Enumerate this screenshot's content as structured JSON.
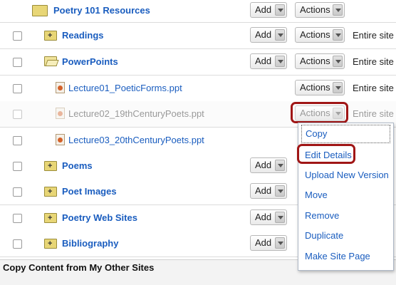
{
  "rows": [
    {
      "name": "Poetry 101 Resources",
      "type": "folder",
      "add_label": "Add",
      "actions_label": "Actions",
      "site": ""
    },
    {
      "name": "Readings",
      "type": "folder",
      "add_label": "Add",
      "actions_label": "Actions",
      "site": "Entire site"
    },
    {
      "name": "PowerPoints",
      "type": "folder-open",
      "add_label": "Add",
      "actions_label": "Actions",
      "site": "Entire site"
    },
    {
      "name": "Lecture01_PoeticForms.ppt",
      "type": "file",
      "actions_label": "Actions",
      "site": "Entire site"
    },
    {
      "name": "Lecture02_19thCenturyPoets.ppt",
      "type": "file-hidden",
      "actions_label": "Actions",
      "site": "Entire site"
    },
    {
      "name": "Lecture03_20thCenturyPoets.ppt",
      "type": "file"
    },
    {
      "name": "Poems",
      "type": "folder",
      "add_label": "Add"
    },
    {
      "name": "Poet Images",
      "type": "folder",
      "add_label": "Add"
    },
    {
      "name": "Poetry Web Sites",
      "type": "folder",
      "add_label": "Add"
    },
    {
      "name": "Bibliography",
      "type": "folder",
      "add_label": "Add"
    }
  ],
  "actions_menu": {
    "items": [
      "Copy",
      "Edit Details",
      "Upload New Version",
      "Move",
      "Remove",
      "Duplicate",
      "Make Site Page"
    ],
    "highlighted": "Edit Details"
  },
  "footer": {
    "label": "Copy Content from My Other Sites"
  },
  "colors": {
    "link": "#1a5dbf",
    "highlight": "#a01616"
  }
}
